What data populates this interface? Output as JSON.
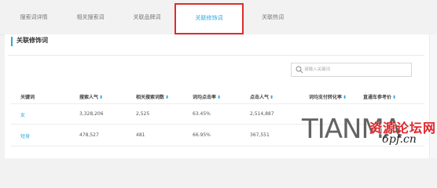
{
  "tabs": [
    {
      "label": "搜索词详情"
    },
    {
      "label": "相关搜索词"
    },
    {
      "label": "关联品牌词"
    },
    {
      "label": "关联修饰词",
      "active": true
    },
    {
      "label": "关联热词"
    }
  ],
  "section": {
    "title": "关联修饰词"
  },
  "search": {
    "placeholder": "请输入关键词"
  },
  "table": {
    "columns": [
      {
        "label": "关键词",
        "sortable": false
      },
      {
        "label": "搜索人气",
        "sortable": true
      },
      {
        "label": "相关搜索词数",
        "sortable": true
      },
      {
        "label": "词均点击率",
        "sortable": true
      },
      {
        "label": "点击人气",
        "sortable": true
      },
      {
        "label": "词均支付转化率",
        "sortable": true
      },
      {
        "label": "直通车参考价",
        "sortable": true
      }
    ],
    "rows": [
      {
        "keyword": "女",
        "search_popularity": "3,328,206",
        "related_count": "2,525",
        "ctr": "63.45%",
        "click_popularity": "2,514,887",
        "conversion": "",
        "ref_price": ""
      },
      {
        "keyword": "短身",
        "search_popularity": "478,527",
        "related_count": "481",
        "ctr": "66.95%",
        "click_popularity": "367,551",
        "conversion": "",
        "ref_price": ""
      }
    ]
  },
  "watermark": {
    "latin": "TIANMA",
    "chinese": "资源论坛网",
    "url": "6pf.cn"
  },
  "colors": {
    "accent": "#2ea7e0",
    "highlight_border": "#e02b2b",
    "watermark_red": "#e0262b"
  },
  "icons": {
    "search": "search-icon",
    "sort": "sort-caret-icon"
  }
}
